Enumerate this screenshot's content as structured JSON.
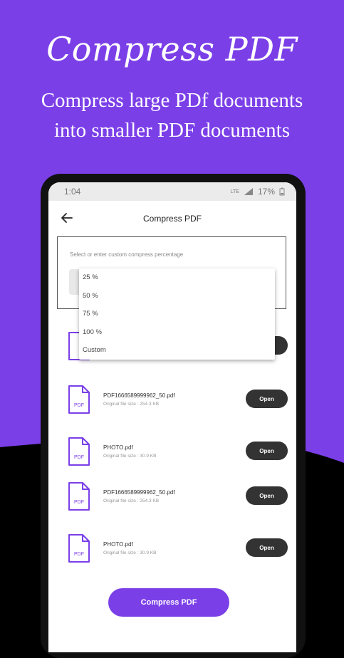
{
  "hero": {
    "title": "Compress PDF",
    "subtitle_line1": "Compress large PDf documents",
    "subtitle_line2": "into smaller PDF documents"
  },
  "statusbar": {
    "time": "1:04",
    "network": "LTE",
    "battery": "17%"
  },
  "appbar": {
    "title": "Compress PDF"
  },
  "compress_panel": {
    "label": "Select or enter custom compress percentage"
  },
  "dropdown": {
    "options": [
      "25 %",
      "50 %",
      "75 %",
      "100 %",
      "Custom"
    ]
  },
  "files": [
    {
      "name": "PDF1666589999962_50.pdf",
      "size": "Original file size : 254.3 KB",
      "action": "Open"
    },
    {
      "name": "PHOTO.pdf",
      "size": "Original file size : 30.9 KB",
      "action": "Open"
    },
    {
      "name": "PDF1666589999962_50.pdf",
      "size": "Original file size : 254.3 KB",
      "action": "Open"
    },
    {
      "name": "PHOTO.pdf",
      "size": "Original file size : 30.9 KB",
      "action": "Open"
    }
  ],
  "footer": {
    "compress_label": "Compress PDF"
  },
  "colors": {
    "accent": "#7b3fe8",
    "button_dark": "#333333"
  }
}
